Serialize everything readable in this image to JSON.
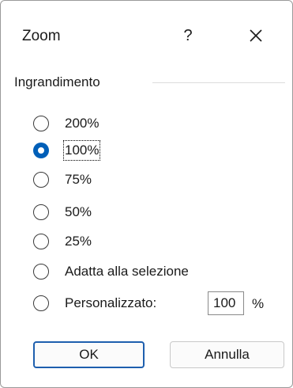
{
  "window": {
    "title": "Zoom",
    "help_label": "?",
    "close_icon": "close-icon"
  },
  "group": {
    "label": "Ingrandimento"
  },
  "options": [
    {
      "label": "200%",
      "checked": false
    },
    {
      "label": "100%",
      "checked": true
    },
    {
      "label": "75%",
      "checked": false
    },
    {
      "label": "50%",
      "checked": false
    },
    {
      "label": "25%",
      "checked": false
    },
    {
      "label": "Adatta alla selezione",
      "checked": false
    },
    {
      "label": "Personalizzato:",
      "checked": false
    }
  ],
  "custom": {
    "value": "100",
    "unit": "%"
  },
  "buttons": {
    "ok_label": "OK",
    "cancel_label": "Annulla"
  },
  "colors": {
    "accent": "#005fb8",
    "ok_border": "#1e5fae"
  }
}
